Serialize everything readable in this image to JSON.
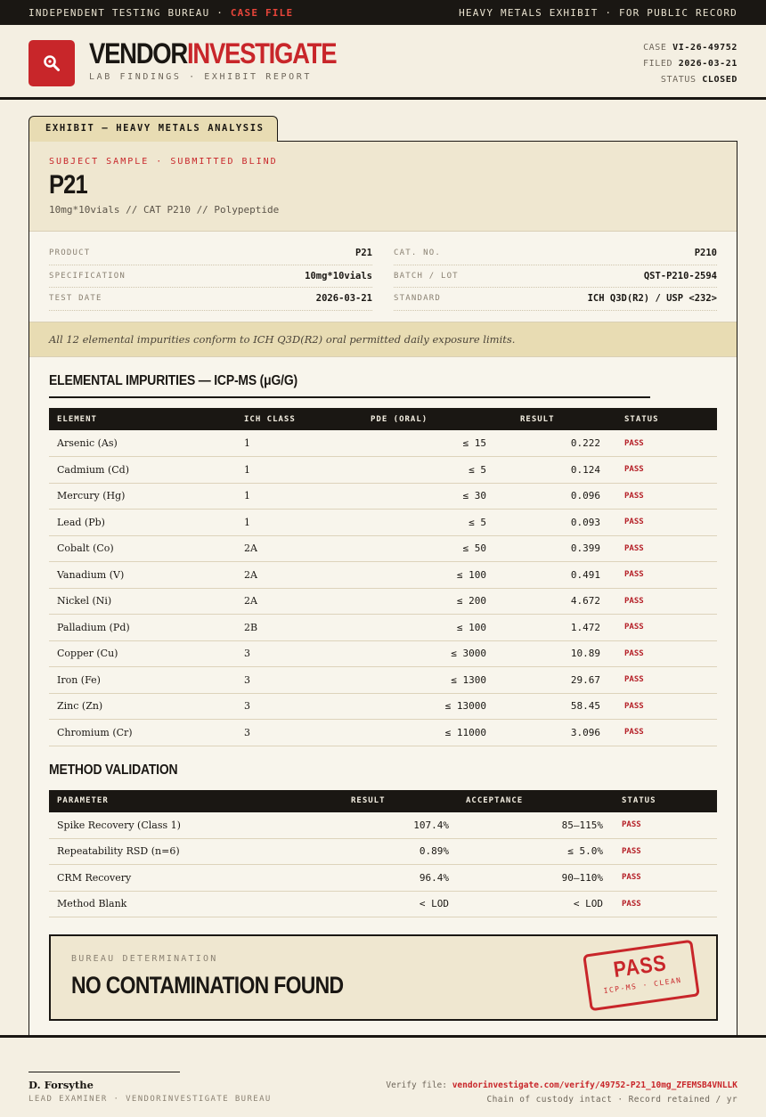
{
  "topbar": {
    "left": "INDEPENDENT TESTING BUREAU · ",
    "left_highlight": "CASE FILE",
    "right": "HEAVY METALS EXHIBIT · FOR PUBLIC RECORD"
  },
  "header": {
    "brand_black": "VENDOR",
    "brand_red": "INVESTIGATE",
    "subtitle": "LAB FINDINGS · EXHIBIT REPORT",
    "logo_icon": "magnifier-icon",
    "case_label": "CASE",
    "case_value": "VI-26-49752",
    "filed_label": "FILED",
    "filed_value": "2026-03-21",
    "status_label": "STATUS",
    "status_value": "CLOSED"
  },
  "exhibit": {
    "tab_label": "EXHIBIT — HEAVY METALS ANALYSIS",
    "eyebrow": "SUBJECT SAMPLE · SUBMITTED BLIND",
    "name": "P21",
    "spec_line": "10mg*10vials  //  CAT P210  //  Polypeptide"
  },
  "fields": {
    "left": [
      {
        "k": "PRODUCT",
        "v": "P21"
      },
      {
        "k": "SPECIFICATION",
        "v": "10mg*10vials"
      },
      {
        "k": "TEST DATE",
        "v": "2026-03-21"
      }
    ],
    "right": [
      {
        "k": "CAT. NO.",
        "v": "P210"
      },
      {
        "k": "BATCH / LOT",
        "v": "QST-P210-2594"
      },
      {
        "k": "STANDARD",
        "v": "ICH Q3D(R2) / USP <232>"
      }
    ]
  },
  "summary": "All 12 elemental impurities conform to ICH Q3D(R2) oral permitted daily exposure limits.",
  "impurities": {
    "title": "ELEMENTAL IMPURITIES — ICP-MS (μG/G)",
    "headers": [
      "ELEMENT",
      "ICH CLASS",
      "PDE (ORAL)",
      "RESULT",
      "STATUS"
    ],
    "rows": [
      {
        "element": "Arsenic (As)",
        "cls": "1",
        "pde": "≤ 15",
        "result": "0.222",
        "status": "PASS"
      },
      {
        "element": "Cadmium (Cd)",
        "cls": "1",
        "pde": "≤ 5",
        "result": "0.124",
        "status": "PASS"
      },
      {
        "element": "Mercury (Hg)",
        "cls": "1",
        "pde": "≤ 30",
        "result": "0.096",
        "status": "PASS"
      },
      {
        "element": "Lead (Pb)",
        "cls": "1",
        "pde": "≤ 5",
        "result": "0.093",
        "status": "PASS"
      },
      {
        "element": "Cobalt (Co)",
        "cls": "2A",
        "pde": "≤ 50",
        "result": "0.399",
        "status": "PASS"
      },
      {
        "element": "Vanadium (V)",
        "cls": "2A",
        "pde": "≤ 100",
        "result": "0.491",
        "status": "PASS"
      },
      {
        "element": "Nickel (Ni)",
        "cls": "2A",
        "pde": "≤ 200",
        "result": "4.672",
        "status": "PASS"
      },
      {
        "element": "Palladium (Pd)",
        "cls": "2B",
        "pde": "≤ 100",
        "result": "1.472",
        "status": "PASS"
      },
      {
        "element": "Copper (Cu)",
        "cls": "3",
        "pde": "≤ 3000",
        "result": "10.89",
        "status": "PASS"
      },
      {
        "element": "Iron (Fe)",
        "cls": "3",
        "pde": "≤ 1300",
        "result": "29.67",
        "status": "PASS"
      },
      {
        "element": "Zinc (Zn)",
        "cls": "3",
        "pde": "≤ 13000",
        "result": "58.45",
        "status": "PASS"
      },
      {
        "element": "Chromium (Cr)",
        "cls": "3",
        "pde": "≤ 11000",
        "result": "3.096",
        "status": "PASS"
      }
    ]
  },
  "validation": {
    "title": "METHOD VALIDATION",
    "headers": [
      "PARAMETER",
      "RESULT",
      "ACCEPTANCE",
      "STATUS"
    ],
    "rows": [
      {
        "param": "Spike Recovery (Class 1)",
        "result": "107.4%",
        "acceptance": "85–115%",
        "status": "PASS"
      },
      {
        "param": "Repeatability RSD (n=6)",
        "result": "0.89%",
        "acceptance": "≤ 5.0%",
        "status": "PASS"
      },
      {
        "param": "CRM Recovery",
        "result": "96.4%",
        "acceptance": "90–110%",
        "status": "PASS"
      },
      {
        "param": "Method Blank",
        "result": "< LOD",
        "acceptance": "< LOD",
        "status": "PASS"
      }
    ]
  },
  "determination": {
    "label": "BUREAU DETERMINATION",
    "verdict": "NO CONTAMINATION FOUND",
    "stamp_main": "PASS",
    "stamp_sub": "ICP-MS · CLEAN"
  },
  "footer": {
    "signer": "D. Forsythe",
    "role": "LEAD EXAMINER · VENDORINVESTIGATE BUREAU",
    "verify_label": "Verify file: ",
    "verify_url": "vendorinvestigate.com/verify/49752-P21_10mg_ZFEMSB4VNLLK",
    "custody": "Chain of custody intact · Record retained / yr"
  },
  "colors": {
    "accent": "#c8262a",
    "ink": "#1a1713",
    "paper": "#f4efe2",
    "highlight": "#e8dcb3"
  }
}
